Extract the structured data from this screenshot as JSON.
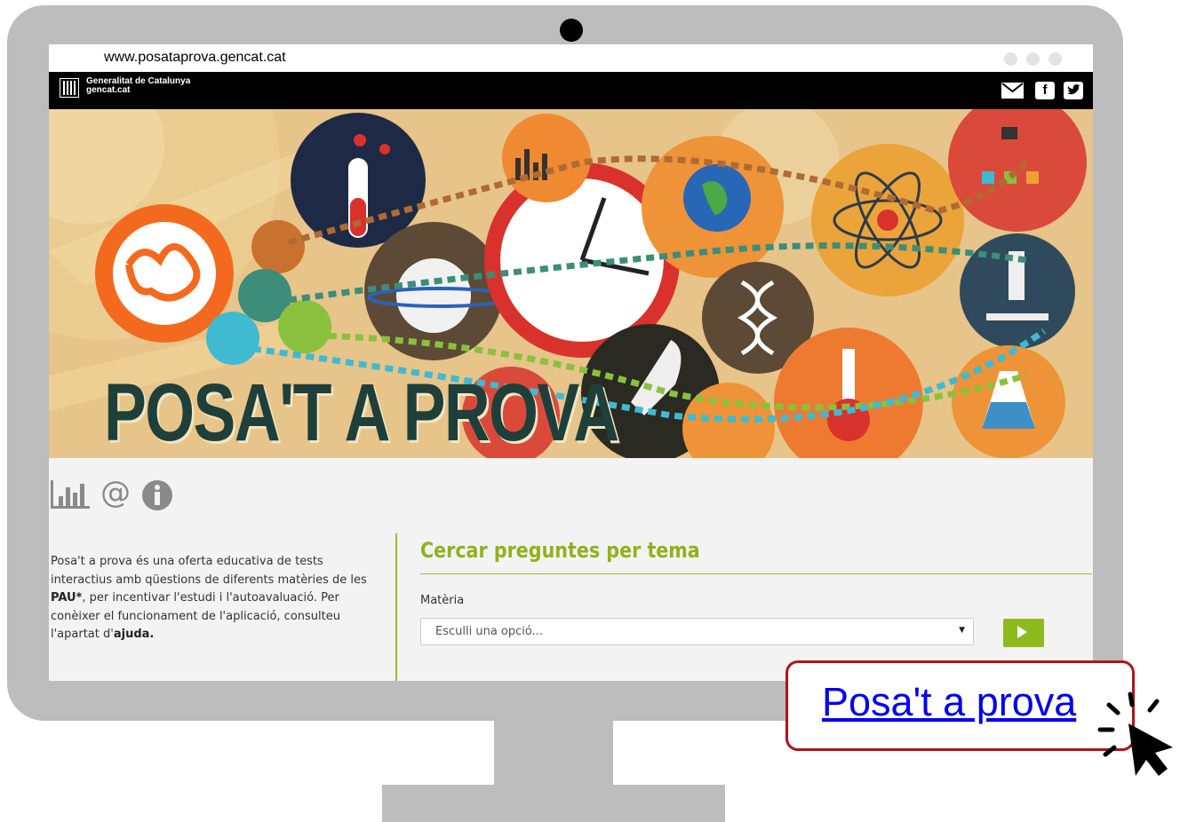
{
  "browser": {
    "url": "www.posataprova.gencat.cat"
  },
  "gencat": {
    "name": "Generalitat de Catalunya",
    "domain": "gencat.cat"
  },
  "banner": {
    "title": "POSA'T A PROVA"
  },
  "icons": [
    "stats-icon",
    "at-icon",
    "info-icon"
  ],
  "intro": {
    "p1": "Posa't a prova és una oferta educativa de tests interactius amb qüestions de diferents matèries de les ",
    "pau": "PAU*",
    "p2": ", per incentivar l'estudi i l'autoavaluació. Per conèixer el funcionament de l'aplicació, consulteu l'apartat d'",
    "ajuda": "ajuda."
  },
  "search": {
    "title": "Cercar preguntes per tema",
    "subject_label": "Matèria",
    "subject_value": "Esculli una opció..."
  },
  "callout": {
    "link_text": "Posa't a prova"
  },
  "colors": {
    "accent_green": "#8dbb1e",
    "callout_border": "#b0141a",
    "link": "#0000ee"
  }
}
